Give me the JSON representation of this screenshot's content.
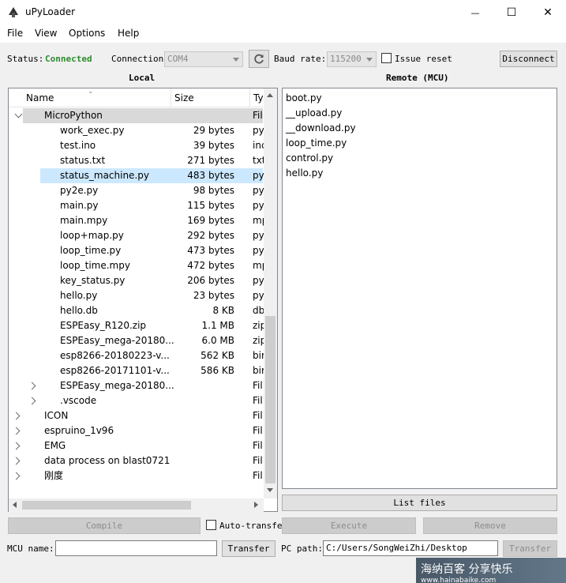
{
  "window": {
    "title": "uPyLoader",
    "minimize_glyph": "—",
    "maximize_glyph": "☐",
    "close_glyph": "✕"
  },
  "menu": [
    "File",
    "View",
    "Options",
    "Help"
  ],
  "connection_bar": {
    "status_label": "Status:",
    "status_value": "Connected",
    "status_color": "#2e8b2e",
    "connection_label": "Connection",
    "port_value": "COM4",
    "baud_label": "Baud rate:",
    "baud_value": "115200",
    "issue_reset_label": "Issue reset",
    "disconnect_label": "Disconnect"
  },
  "local": {
    "title": "Local",
    "columns": [
      "Name",
      "Size",
      "Ty"
    ],
    "rows": [
      {
        "name": "MicroPython",
        "size": "",
        "type": "Fil",
        "level": 0,
        "expander": "down",
        "style": "hilite"
      },
      {
        "name": "work_exec.py",
        "size": "29 bytes",
        "type": "py",
        "level": 1
      },
      {
        "name": "test.ino",
        "size": "39 bytes",
        "type": "inc",
        "level": 1
      },
      {
        "name": "status.txt",
        "size": "271 bytes",
        "type": "txt",
        "level": 1
      },
      {
        "name": "status_machine.py",
        "size": "483 bytes",
        "type": "py",
        "level": 1,
        "style": "selected"
      },
      {
        "name": "py2e.py",
        "size": "98 bytes",
        "type": "py",
        "level": 1
      },
      {
        "name": "main.py",
        "size": "115 bytes",
        "type": "py",
        "level": 1
      },
      {
        "name": "main.mpy",
        "size": "169 bytes",
        "type": "mp",
        "level": 1
      },
      {
        "name": "loop+map.py",
        "size": "292 bytes",
        "type": "py",
        "level": 1
      },
      {
        "name": "loop_time.py",
        "size": "473 bytes",
        "type": "py",
        "level": 1
      },
      {
        "name": "loop_time.mpy",
        "size": "472 bytes",
        "type": "mp",
        "level": 1
      },
      {
        "name": "key_status.py",
        "size": "206 bytes",
        "type": "py",
        "level": 1
      },
      {
        "name": "hello.py",
        "size": "23 bytes",
        "type": "py",
        "level": 1
      },
      {
        "name": "hello.db",
        "size": "8 KB",
        "type": "db",
        "level": 1
      },
      {
        "name": "ESPEasy_R120.zip",
        "size": "1.1 MB",
        "type": "zip",
        "level": 1
      },
      {
        "name": "ESPEasy_mega-20180...",
        "size": "6.0 MB",
        "type": "zip",
        "level": 1
      },
      {
        "name": "esp8266-20180223-v...",
        "size": "562 KB",
        "type": "bir",
        "level": 1
      },
      {
        "name": "esp8266-20171101-v...",
        "size": "586 KB",
        "type": "bir",
        "level": 1
      },
      {
        "name": "ESPEasy_mega-20180...",
        "size": "",
        "type": "Fil",
        "level": 1,
        "expander": "right"
      },
      {
        "name": ".vscode",
        "size": "",
        "type": "Fil",
        "level": 1,
        "expander": "right"
      },
      {
        "name": "ICON",
        "size": "",
        "type": "Fil",
        "level": 0,
        "expander": "right"
      },
      {
        "name": "espruino_1v96",
        "size": "",
        "type": "Fil",
        "level": 0,
        "expander": "right"
      },
      {
        "name": "EMG",
        "size": "",
        "type": "Fil",
        "level": 0,
        "expander": "right"
      },
      {
        "name": "data process on blast0721",
        "size": "",
        "type": "Fil",
        "level": 0,
        "expander": "right"
      },
      {
        "name": "刚度",
        "size": "",
        "type": "Fil",
        "level": 0,
        "expander": "right"
      }
    ]
  },
  "remote": {
    "title": "Remote (MCU)",
    "files": [
      "boot.py",
      "__upload.py",
      "__download.py",
      "loop_time.py",
      "control.py",
      "hello.py"
    ],
    "list_files_label": "List files"
  },
  "actions": {
    "compile_label": "Compile",
    "auto_transfer_label": "Auto-transfe",
    "execute_label": "Execute",
    "remove_label": "Remove"
  },
  "transfer_bar": {
    "mcu_name_label": "MCU name:",
    "mcu_name_value": "",
    "transfer_label": "Transfer",
    "pc_path_label": "PC path:",
    "pc_path_value": "C:/Users/SongWeiZhi/Desktop",
    "transfer2_label": "Transfer"
  },
  "watermark": {
    "text": "海纳百客 分享快乐",
    "sub": "www.hainabaike.com"
  }
}
